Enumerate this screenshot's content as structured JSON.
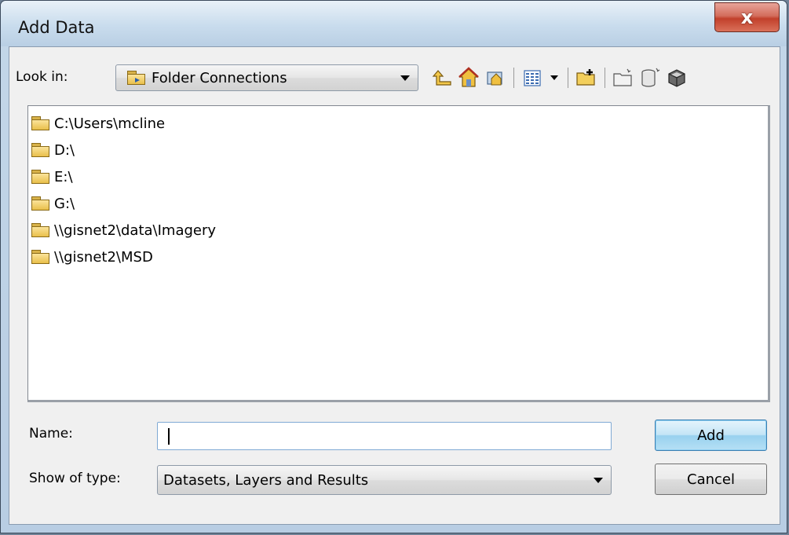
{
  "window": {
    "title": "Add Data",
    "close_glyph": "x"
  },
  "look_in": {
    "label": "Look in:",
    "value": "Folder Connections",
    "icon": "folder-connections-icon"
  },
  "toolbar": {
    "buttons": [
      {
        "name": "up-one-level-icon"
      },
      {
        "name": "home-icon"
      },
      {
        "name": "connect-to-folder-icon"
      },
      {
        "name": "list-view-icon"
      },
      {
        "name": "view-dropdown-icon"
      },
      {
        "name": "connect-folder-icon"
      },
      {
        "name": "new-folder-icon"
      },
      {
        "name": "new-geodatabase-icon"
      },
      {
        "name": "new-toolbox-icon"
      }
    ]
  },
  "items": [
    {
      "label": "C:\\Users\\mcline"
    },
    {
      "label": "D:\\"
    },
    {
      "label": "E:\\"
    },
    {
      "label": "G:\\"
    },
    {
      "label": "\\\\gisnet2\\data\\Imagery"
    },
    {
      "label": "\\\\gisnet2\\MSD"
    }
  ],
  "name_field": {
    "label": "Name:",
    "value": ""
  },
  "type_field": {
    "label": "Show of type:",
    "value": "Datasets, Layers and Results"
  },
  "buttons": {
    "add": "Add",
    "cancel": "Cancel"
  },
  "colors": {
    "accent": "#3c7fb1",
    "close": "#c2402b",
    "folder": "#e9bf4b"
  }
}
